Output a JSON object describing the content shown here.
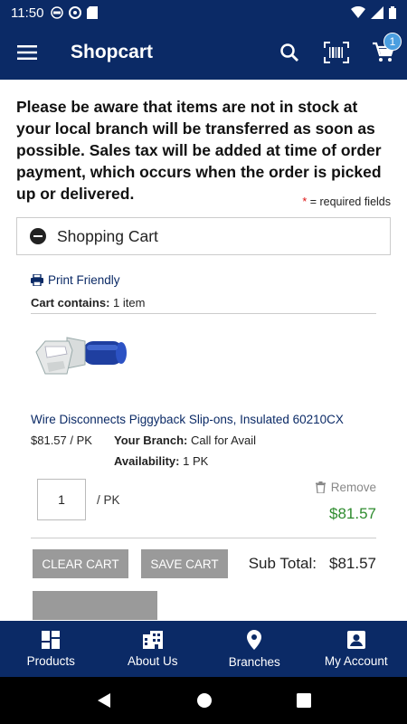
{
  "status_bar": {
    "time": "11:50"
  },
  "app_bar": {
    "title": "Shopcart",
    "cart_count": "1"
  },
  "notice": "Please be aware that items are not in stock at your local branch will be transferred as soon as possible. Sales tax will be added at time of order payment, which occurs when the order is picked up or delivered.",
  "required": {
    "star": "*",
    "text": " = required fields"
  },
  "section": {
    "title": "Shopping Cart"
  },
  "cart": {
    "print_label": "Print Friendly",
    "contains_label": "Cart contains:",
    "contains_value": " 1 item",
    "item": {
      "name": "Wire Disconnects Piggyback Slip-ons, Insulated 60210CX",
      "price": "$81.57 / PK",
      "branch_label": "Your Branch:",
      "branch_value": " Call for Avail",
      "availability_label": "Availability:",
      "availability_value": " 1 PK",
      "quantity": "1",
      "unit": "/  PK",
      "remove_label": "Remove",
      "line_total": "$81.57"
    },
    "clear_label": "CLEAR CART",
    "save_label": "SAVE CART",
    "subtotal_label": "Sub Total:",
    "subtotal_value": "$81.57"
  },
  "bottom_nav": [
    {
      "label": "Products",
      "icon": "grid-icon"
    },
    {
      "label": "About Us",
      "icon": "building-icon"
    },
    {
      "label": "Branches",
      "icon": "location-pin-icon"
    },
    {
      "label": "My Account",
      "icon": "account-icon"
    }
  ],
  "colors": {
    "brand": "#0b2a66",
    "badge": "#4a9ee0",
    "total": "#2e8b2e",
    "button": "#9a9a9a"
  }
}
